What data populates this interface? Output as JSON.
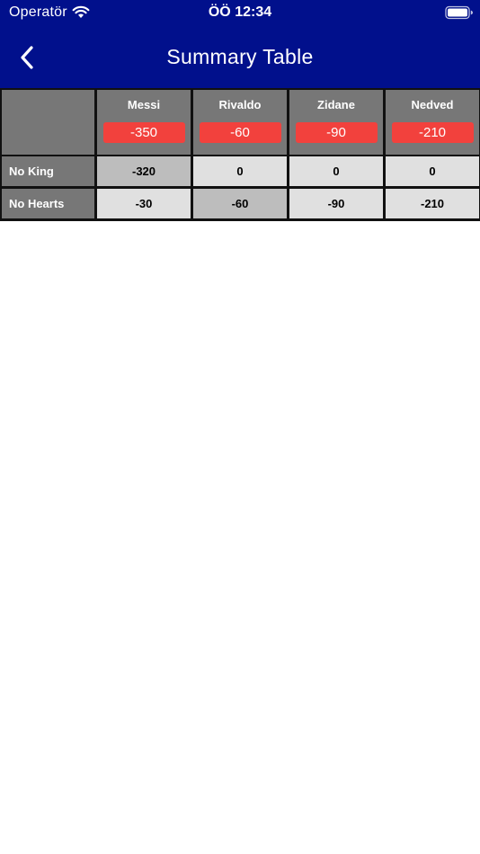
{
  "status_bar": {
    "carrier": "Operatör",
    "time": "ÖÖ 12:34",
    "wifi_icon": "wifi-icon",
    "battery_icon": "battery-full-icon"
  },
  "nav": {
    "back_icon": "chevron-left-icon",
    "title": "Summary Table"
  },
  "colors": {
    "nav_background": "#01108c",
    "header_cell": "#777777",
    "value_cell": "#e0e0e0",
    "highlight_cell": "#bdbdbd",
    "total_badge": "#f2413d"
  },
  "table": {
    "corner_label": "",
    "players": [
      {
        "name": "Messi",
        "total": "-350"
      },
      {
        "name": "Rivaldo",
        "total": "-60"
      },
      {
        "name": "Zidane",
        "total": "-90"
      },
      {
        "name": "Nedved",
        "total": "-210"
      }
    ],
    "rows": [
      {
        "label": "No King",
        "values": [
          "-320",
          "0",
          "0",
          "0"
        ],
        "highlight_index": 0
      },
      {
        "label": "No Hearts",
        "values": [
          "-30",
          "-60",
          "-90",
          "-210"
        ],
        "highlight_index": 1
      }
    ]
  }
}
